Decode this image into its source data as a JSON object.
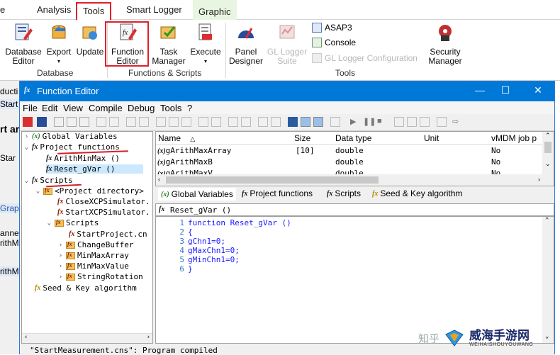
{
  "ribbon": {
    "tabs": [
      {
        "label": "Home"
      },
      {
        "label": "Analysis"
      },
      {
        "label": "Tools"
      },
      {
        "label": "Smart Logger"
      },
      {
        "label": "Graphic"
      }
    ],
    "buttons": {
      "database_editor": "Database Editor",
      "export": "Export",
      "update": "Update",
      "function_editor": "Function Editor",
      "task_manager": "Task Manager",
      "execute": "Execute",
      "panel_designer": "Panel Designer",
      "gl_logger_suite": "GL Logger Suite",
      "asap3": "ASAP3",
      "console": "Console",
      "gl_logger_config": "GL Logger Configuration",
      "security_manager": "Security Manager"
    },
    "groups": {
      "database": "Database",
      "functions_scripts": "Functions & Scripts",
      "tools": "Tools"
    }
  },
  "background": {
    "frag1": "ducti",
    "frag2": "Start",
    "frag3": "rt ar",
    "frag4": "Star",
    "frag5": "Grap",
    "frag6": "anne",
    "frag7": "rithM",
    "frag8": "rithM"
  },
  "window": {
    "title": "Function Editor",
    "menu": [
      "File",
      "Edit",
      "View",
      "Compile",
      "Debug",
      "Tools",
      "?"
    ]
  },
  "tree": {
    "global_variables": "Global Variables",
    "project_functions": "Project functions",
    "arith_min_max": "ArithMinMax ()",
    "reset_gvar": "Reset_gVar ()",
    "scripts": "Scripts",
    "project_directory": "<Project directory>",
    "close_xcp": "CloseXCPSimulator.",
    "start_xcp": "StartXCPSimulator.",
    "scripts_sub": "Scripts",
    "start_project": "StartProject.cn",
    "change_buffer": "ChangeBuffer",
    "min_max_array": "MinMaxArray",
    "min_max_value": "MinMaxValue",
    "string_rotation": "StringRotation",
    "seed_key": "Seed & Key algorithm"
  },
  "grid": {
    "headers": {
      "name": "Name",
      "size": "Size",
      "type": "Data type",
      "unit": "Unit",
      "vmdm": "vMDM job p"
    },
    "sort_icon": "△",
    "rows": [
      {
        "name": "gArithMaxArray",
        "size": "[10]",
        "type": "double",
        "vmdm": "No"
      },
      {
        "name": "gArithMaxB",
        "size": "",
        "type": "double",
        "vmdm": "No"
      },
      {
        "name": "gArithMaxV",
        "size": "",
        "type": "double",
        "vmdm": "No"
      }
    ]
  },
  "tabs": [
    {
      "icon": "(x)",
      "label": "Global Variables"
    },
    {
      "icon": "fx",
      "label": "Project functions"
    },
    {
      "icon": "fx",
      "label": "Scripts"
    },
    {
      "icon": "fx",
      "label": "Seed & Key algorithm"
    }
  ],
  "editor": {
    "header": "Reset_gVar ()",
    "lines": [
      {
        "n": "1",
        "code": "function Reset_gVar ()"
      },
      {
        "n": "2",
        "code": "{"
      },
      {
        "n": "3",
        "code": "gChn1=0;"
      },
      {
        "n": "4",
        "code": "gMaxChn1=0;"
      },
      {
        "n": "5",
        "code": "gMinChn1=0;"
      },
      {
        "n": "6",
        "code": "}"
      }
    ]
  },
  "status": "\"StartMeasurement.cns\": Program compiled",
  "watermark": {
    "site_cn": "威海手游网",
    "site_en": "WEIHAISHOUYOUWANG",
    "zhihu": "知乎"
  },
  "colors": {
    "titlebar": "#0078d7",
    "highlight_red": "#e0202a",
    "selection": "#cce8ff",
    "code_blue": "#1a1aff"
  }
}
